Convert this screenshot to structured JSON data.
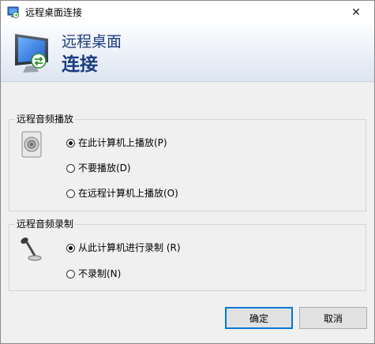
{
  "window": {
    "title": "远程桌面连接",
    "close_glyph": "✕",
    "icons": {
      "title": "remote-desktop-icon",
      "close": "close-icon"
    }
  },
  "banner": {
    "line1": "远程桌面",
    "line2": "连接",
    "icon": "remote-desktop-monitor-icon",
    "text_color": "#1a3c7d"
  },
  "audio_playback": {
    "title": "远程音频播放",
    "icon": "speaker-icon",
    "options": [
      {
        "label": "在此计算机上播放(P)",
        "checked": true
      },
      {
        "label": "不要播放(D)",
        "checked": false
      },
      {
        "label": "在远程计算机上播放(O)",
        "checked": false
      }
    ]
  },
  "audio_recording": {
    "title": "远程音频录制",
    "icon": "microphone-icon",
    "options": [
      {
        "label": "从此计算机进行录制 (R)",
        "checked": true
      },
      {
        "label": "不录制(N)",
        "checked": false
      }
    ]
  },
  "buttons": {
    "ok": "确定",
    "cancel": "取消",
    "accent": "#0078d7"
  }
}
